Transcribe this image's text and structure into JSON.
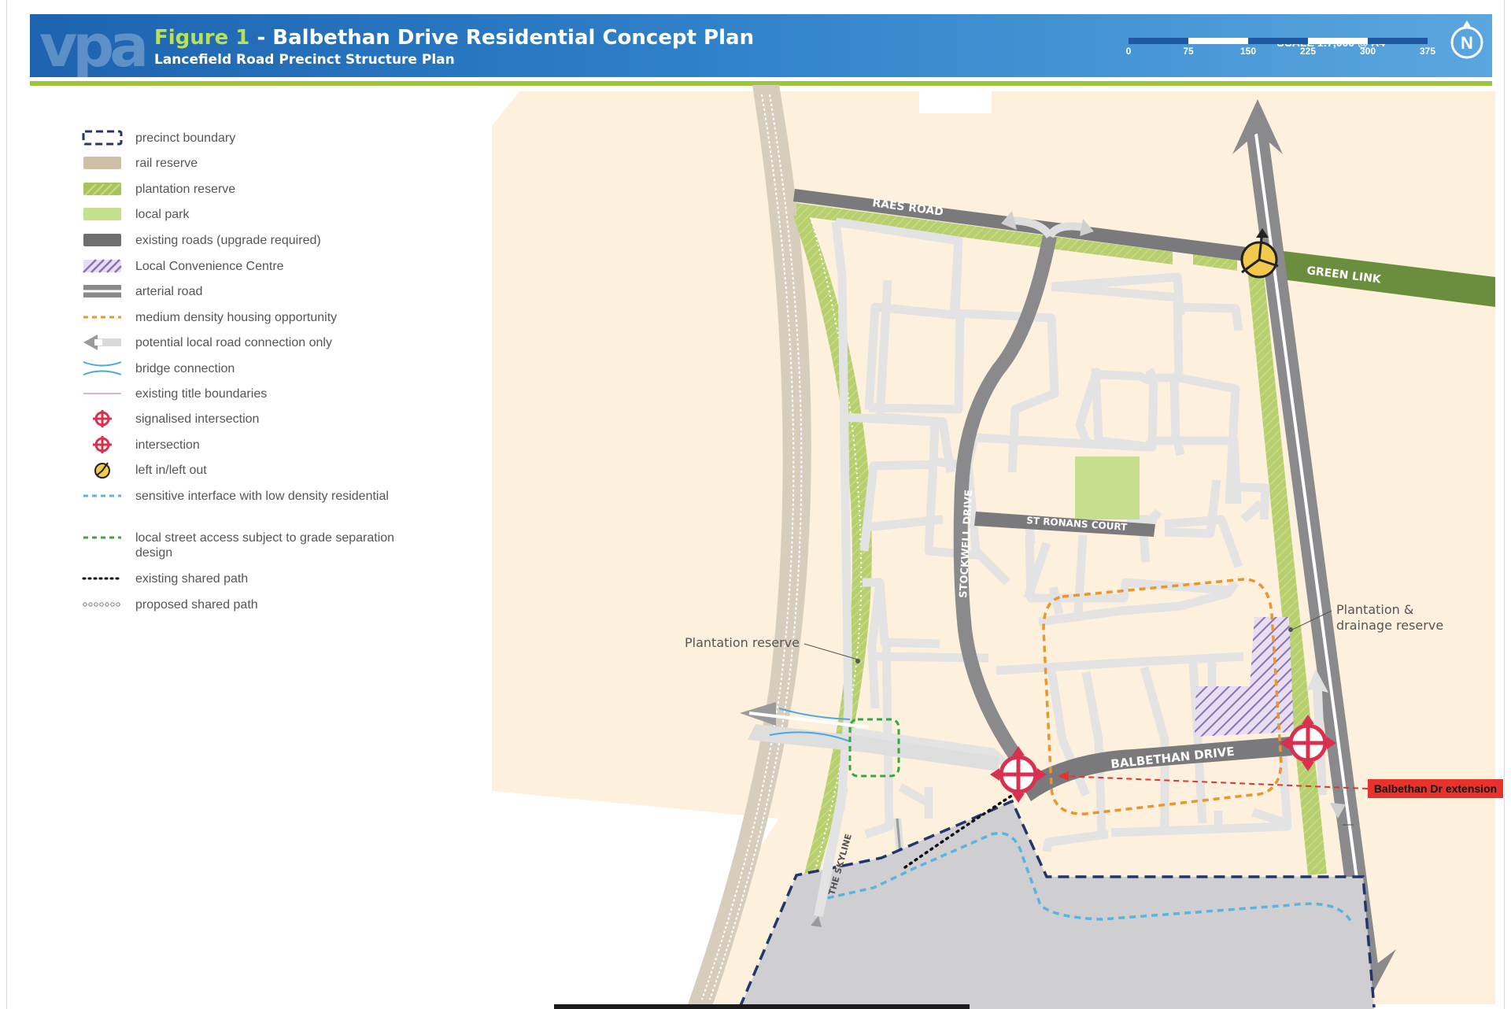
{
  "header": {
    "logo": "vpa",
    "figure_label": "Figure 1",
    "title_rest": " - Balbethan Drive Residential Concept Plan",
    "subtitle": "Lancefield Road Precinct Structure Plan",
    "scale_label": "SCALE 1:7,000 @ A4",
    "scale_ticks": [
      "0",
      "75",
      "150",
      "225",
      "300",
      "375"
    ],
    "north_label": "N"
  },
  "legend": {
    "items": [
      {
        "label": "precinct boundary",
        "icon": "dashed-boundary-icon"
      },
      {
        "label": "rail reserve",
        "icon": "rail-reserve-swatch"
      },
      {
        "label": "plantation reserve",
        "icon": "plantation-reserve-swatch"
      },
      {
        "label": "local park",
        "icon": "local-park-swatch"
      },
      {
        "label": "existing roads (upgrade required)",
        "icon": "existing-road-swatch"
      },
      {
        "label": "Local Convenience Centre",
        "icon": "hatched-swatch"
      },
      {
        "label": "arterial road",
        "icon": "arterial-road-icon"
      },
      {
        "label": "medium density housing opportunity",
        "icon": "orange-dashed-line"
      },
      {
        "label": "potential local road connection only",
        "icon": "arrow-left-icon"
      },
      {
        "label": "bridge connection",
        "icon": "bridge-icon"
      },
      {
        "label": "existing title boundaries",
        "icon": "thin-red-line"
      },
      {
        "label": "signalised intersection",
        "icon": "signalised-intersection-icon"
      },
      {
        "label": "intersection",
        "icon": "intersection-icon"
      },
      {
        "label": "left in/left out",
        "icon": "left-in-left-out-icon"
      },
      {
        "label": "sensitive interface with low density residential",
        "icon": "blue-dashed-line"
      },
      {
        "label": "local street access subject to grade separation design",
        "icon": "green-dashed-line"
      },
      {
        "label": "existing shared path",
        "icon": "dotted-line"
      },
      {
        "label": "proposed shared path",
        "icon": "circles-line"
      }
    ]
  },
  "map_labels": {
    "raes_road": "RAES ROAD",
    "green_link": "GREEN LINK",
    "stockwell_drive": "STOCKWELL DRIVE",
    "st_ronans_court": "ST RONANS COURT",
    "balbethan_drive": "BALBETHAN DRIVE",
    "the_skyline": "THE SKYLINE",
    "plantation_reserve": "Plantation reserve",
    "plantation_drainage_line1": "Plantation &",
    "plantation_drainage_line2": "drainage reserve",
    "extension_callout": "Balbethan Dr extension"
  },
  "colors": {
    "land": "#fdf0dd",
    "local_road": "#e3e3e3",
    "existing_road": "#8a8a8c",
    "plantation": "#b7cf6e",
    "park": "#c5df8f",
    "green_link": "#6b8e3e",
    "boundary": "#22366b",
    "signal": "#d8304f",
    "medium_density": "#e8962e",
    "sensitive": "#5bb3e0",
    "callout": "#e8322b"
  }
}
